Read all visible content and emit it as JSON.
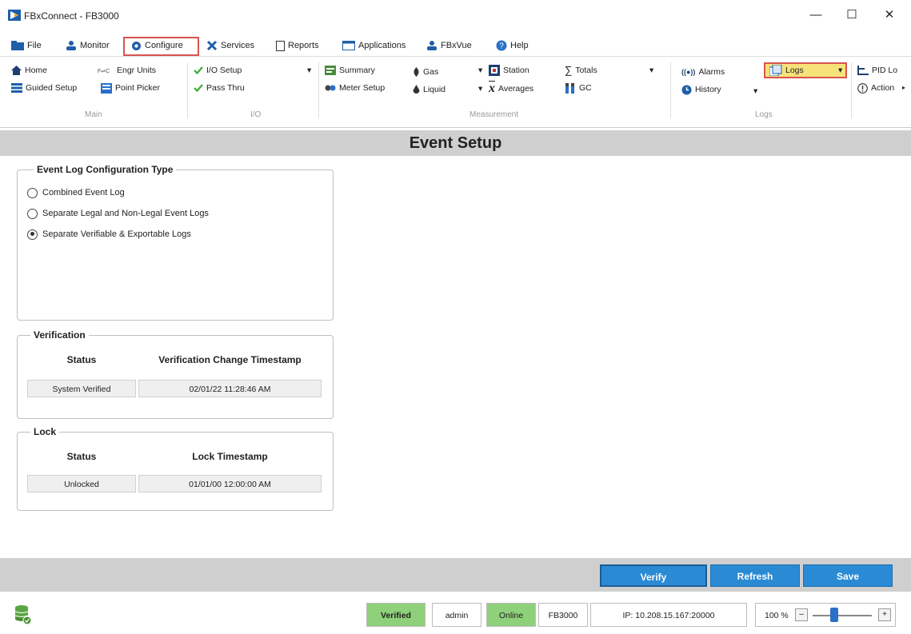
{
  "window": {
    "title": "FBxConnect - FB3000",
    "minimize": "—",
    "maximize": "☐",
    "close": "✕"
  },
  "menu": {
    "file": "File",
    "monitor": "Monitor",
    "configure": "Configure",
    "services": "Services",
    "reports": "Reports",
    "applications": "Applications",
    "fbxvue": "FBxVue",
    "help": "Help"
  },
  "ribbon": {
    "main": {
      "home": "Home",
      "engr_units": "Engr Units",
      "guided_setup": "Guided Setup",
      "point_picker": "Point Picker",
      "label": "Main"
    },
    "io": {
      "io_setup": "I/O Setup",
      "pass_thru": "Pass Thru",
      "label": "I/O"
    },
    "measurement": {
      "summary": "Summary",
      "meter_setup": "Meter Setup",
      "gas": "Gas",
      "liquid": "Liquid",
      "station": "Station",
      "averages": "Averages",
      "totals": "Totals",
      "gc": "GC",
      "label": "Measurement"
    },
    "logs": {
      "alarms": "Alarms",
      "history": "History",
      "logs": "Logs",
      "label": "Logs"
    },
    "extra": {
      "pid": "PID Lo",
      "actions": "Action"
    }
  },
  "page": {
    "title": "Event Setup"
  },
  "event_log": {
    "legend": "Event Log Configuration Type",
    "options": [
      "Combined Event Log",
      "Separate Legal and Non-Legal Event Logs",
      "Separate Verifiable & Exportable Logs"
    ],
    "selected_index": 2
  },
  "verification": {
    "legend": "Verification",
    "status_header": "Status",
    "timestamp_header": "Verification Change Timestamp",
    "status": "System Verified",
    "timestamp": "02/01/22 11:28:46 AM"
  },
  "lock": {
    "legend": "Lock",
    "status_header": "Status",
    "timestamp_header": "Lock Timestamp",
    "status": "Unlocked",
    "timestamp": "01/01/00 12:00:00 AM"
  },
  "actions": {
    "verify": "Verify",
    "refresh": "Refresh",
    "save": "Save"
  },
  "status": {
    "verified": "Verified",
    "user": "admin",
    "online": "Online",
    "device": "FB3000",
    "ip": "IP: 10.208.15.167:20000",
    "zoom": "100 %",
    "zoom_minus": "–",
    "zoom_plus": "+"
  },
  "colors": {
    "accent_blue": "#2a8ad4",
    "status_green": "#8fd07a",
    "highlight_red": "#d9534f",
    "logs_yellow": "#f7e27a"
  }
}
